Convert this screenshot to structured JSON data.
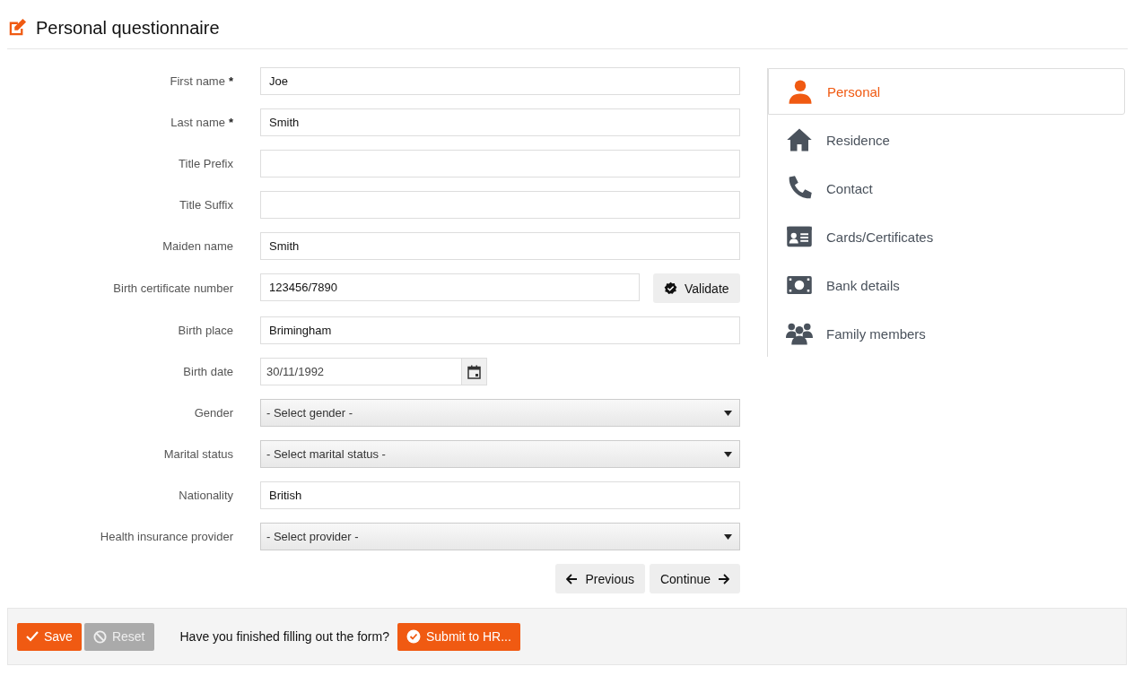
{
  "header": {
    "title": "Personal questionnaire"
  },
  "form": {
    "fields": [
      {
        "kind": "text",
        "label": "First name",
        "required_mark": "*",
        "value": "Joe"
      },
      {
        "kind": "text",
        "label": "Last name",
        "required_mark": "*",
        "value": "Smith"
      },
      {
        "kind": "text",
        "label": "Title Prefix"
      },
      {
        "kind": "text",
        "label": "Title Suffix"
      },
      {
        "kind": "text",
        "label": "Maiden name",
        "value": "Smith"
      },
      {
        "kind": "validate",
        "label": "Birth certificate number",
        "value": "123456/7890",
        "button": "Validate"
      },
      {
        "kind": "text",
        "label": "Birth place",
        "value": "Brimingham"
      },
      {
        "kind": "date",
        "label": "Birth date",
        "value": "30/11/1992"
      },
      {
        "kind": "select",
        "label": "Gender",
        "value": "- Select gender -"
      },
      {
        "kind": "select",
        "label": "Marital status",
        "value": "- Select marital status -"
      },
      {
        "kind": "text",
        "label": "Nationality",
        "value": "British"
      },
      {
        "kind": "select",
        "label": "Health insurance provider",
        "value": "- Select provider -"
      }
    ],
    "previous": "Previous",
    "continue": "Continue"
  },
  "nav": {
    "items": [
      {
        "kind": "person",
        "label": "Personal",
        "selected": true
      },
      {
        "kind": "house",
        "label": "Residence",
        "selected": false
      },
      {
        "kind": "phone",
        "label": "Contact",
        "selected": false
      },
      {
        "kind": "card",
        "label": "Cards/Certificates",
        "selected": false
      },
      {
        "kind": "money",
        "label": "Bank details",
        "selected": false
      },
      {
        "kind": "people",
        "label": "Family members",
        "selected": false
      }
    ]
  },
  "footer": {
    "save": {
      "label": "Save",
      "disabled": false
    },
    "reset": {
      "label": "Reset",
      "disabled": true
    },
    "question": "Have you finished filling out the form?",
    "submit": "Submit to HR..."
  }
}
